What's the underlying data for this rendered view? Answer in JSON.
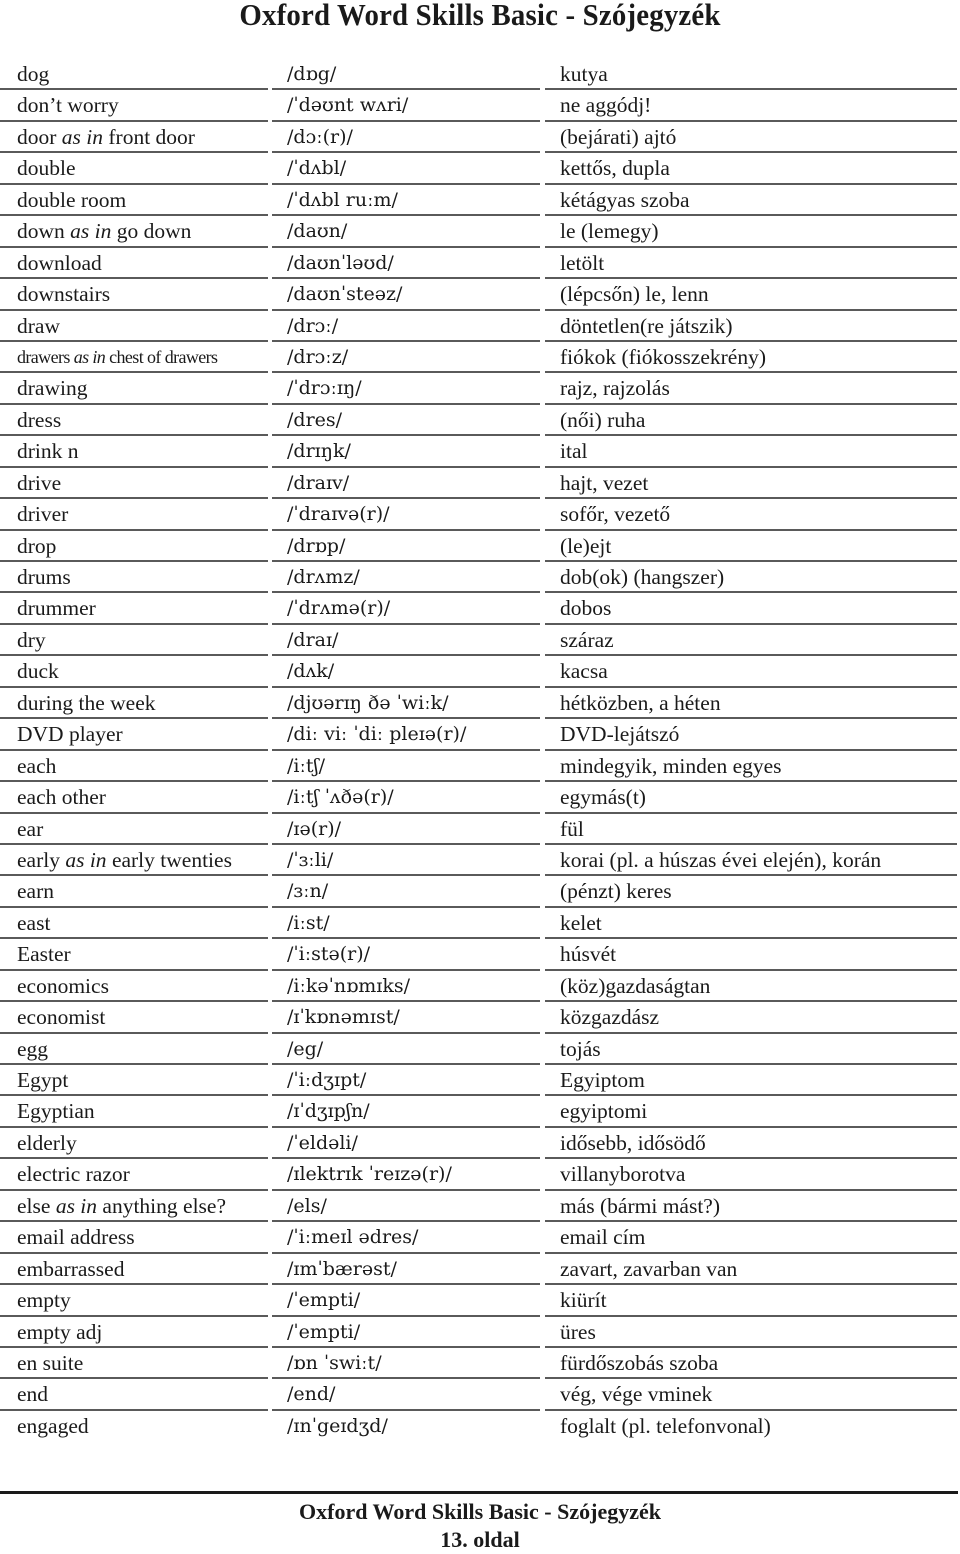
{
  "header": {
    "title": "Oxford Word Skills Basic - Szójegyzék"
  },
  "entries": [
    {
      "word": "dog",
      "ipa": "/dɒg/",
      "hu": "kutya"
    },
    {
      "word": "don’t worry",
      "ipa": "/ˈdəʊnt wʌri/",
      "hu": "ne aggódj!"
    },
    {
      "word": "door",
      "note": "as in",
      "word_after": "front door",
      "ipa": "/dɔː(r)/",
      "hu": "(bejárati) ajtó"
    },
    {
      "word": "double",
      "ipa": "/ˈdʌbl/",
      "hu": "kettős, dupla"
    },
    {
      "word": "double room",
      "ipa": "/ˈdʌbl ruːm/",
      "hu": "kétágyas szoba"
    },
    {
      "word": "down",
      "note": "as in",
      "word_after": "go down",
      "ipa": "/daʊn/",
      "hu": "le (lemegy)"
    },
    {
      "word": "download",
      "ipa": "/daʊnˈləʊd/",
      "hu": "letölt"
    },
    {
      "word": "downstairs",
      "ipa": "/daʊnˈsteəz/",
      "hu": "(lépcsőn) le, lenn"
    },
    {
      "word": "draw",
      "ipa": "/drɔː/",
      "hu": "döntetlen(re játszik)"
    },
    {
      "word": "drawers",
      "note": "as in",
      "word_after": "chest of drawers",
      "ipa": "/drɔːz/",
      "hu": "fiókok (fiókosszekrény)",
      "small": true
    },
    {
      "word": "drawing",
      "ipa": "/ˈdrɔːɪŋ/",
      "hu": "rajz, rajzolás"
    },
    {
      "word": "dress",
      "ipa": "/dres/",
      "hu": "(női) ruha"
    },
    {
      "word": "drink n",
      "ipa": "/drɪŋk/",
      "hu": "ital"
    },
    {
      "word": "drive",
      "ipa": "/draɪv/",
      "hu": "hajt, vezet"
    },
    {
      "word": "driver",
      "ipa": "/ˈdraɪvə(r)/",
      "hu": "sofőr, vezető"
    },
    {
      "word": "drop",
      "ipa": "/drɒp/",
      "hu": "(le)ejt"
    },
    {
      "word": "drums",
      "ipa": "/drʌmz/",
      "hu": "dob(ok) (hangszer)"
    },
    {
      "word": "drummer",
      "ipa": "/ˈdrʌmə(r)/",
      "hu": "dobos"
    },
    {
      "word": "dry",
      "ipa": "/draɪ/",
      "hu": "száraz"
    },
    {
      "word": "duck",
      "ipa": "/dʌk/",
      "hu": "kacsa"
    },
    {
      "word": "during the week",
      "ipa": "/djʊərɪŋ ðə ˈwiːk/",
      "hu": "hétközben, a héten"
    },
    {
      "word": "DVD player",
      "ipa": "/diː viː ˈdiː pleɪə(r)/",
      "hu": "DVD-lejátszó"
    },
    {
      "word": "each",
      "ipa": "/iːtʃ/",
      "hu": "mindegyik, minden egyes"
    },
    {
      "word": "each other",
      "ipa": "/iːtʃ ˈʌðə(r)/",
      "hu": "egymás(t)"
    },
    {
      "word": "ear",
      "ipa": "/ɪə(r)/",
      "hu": "fül"
    },
    {
      "word": "early",
      "note": "as in",
      "word_after": "early twenties",
      "ipa": "/ˈɜːli/",
      "hu": "korai (pl. a húszas évei elején), korán"
    },
    {
      "word": "earn",
      "ipa": "/ɜːn/",
      "hu": "(pénzt) keres"
    },
    {
      "word": "east",
      "ipa": "/iːst/",
      "hu": "kelet"
    },
    {
      "word": "Easter",
      "ipa": "/ˈiːstə(r)/",
      "hu": "húsvét"
    },
    {
      "word": "economics",
      "ipa": "/iːkəˈnɒmɪks/",
      "hu": "(köz)gazdaságtan"
    },
    {
      "word": "economist",
      "ipa": "/ɪˈkɒnəmɪst/",
      "hu": "közgazdász"
    },
    {
      "word": "egg",
      "ipa": "/eg/",
      "hu": "tojás"
    },
    {
      "word": "Egypt",
      "ipa": "/ˈiːdʒɪpt/",
      "hu": "Egyiptom"
    },
    {
      "word": "Egyptian",
      "ipa": "/ɪˈdʒɪpʃn/",
      "hu": "egyiptomi"
    },
    {
      "word": "elderly",
      "ipa": "/ˈeldəli/",
      "hu": "idősebb, idősödő"
    },
    {
      "word": "electric razor",
      "ipa": "/ɪlektrɪk ˈreɪzə(r)/",
      "hu": "villanyborotva"
    },
    {
      "word": "else",
      "note": "as in",
      "word_after": "anything else?",
      "ipa": "/els/",
      "hu": "más (bármi mást?)"
    },
    {
      "word": "email address",
      "ipa": "/ˈiːmeɪl ədres/",
      "hu": "email cím"
    },
    {
      "word": "embarrassed",
      "ipa": "/ɪmˈbærəst/",
      "hu": "zavart, zavarban van"
    },
    {
      "word": "empty",
      "ipa": "/ˈempti/",
      "hu": "kiürít"
    },
    {
      "word": "empty adj",
      "ipa": "/ˈempti/",
      "hu": "üres"
    },
    {
      "word": "en suite",
      "ipa": "/ɒn ˈswiːt/",
      "hu": "fürdőszobás szoba"
    },
    {
      "word": "end",
      "ipa": "/end/",
      "hu": "vég, vége vminek"
    },
    {
      "word": "engaged",
      "ipa": "/ɪnˈgeɪdʒd/",
      "hu": "foglalt (pl. telefonvonal)"
    }
  ],
  "footer": {
    "title": "Oxford Word Skills Basic - Szójegyzék",
    "page": "13. oldal"
  }
}
